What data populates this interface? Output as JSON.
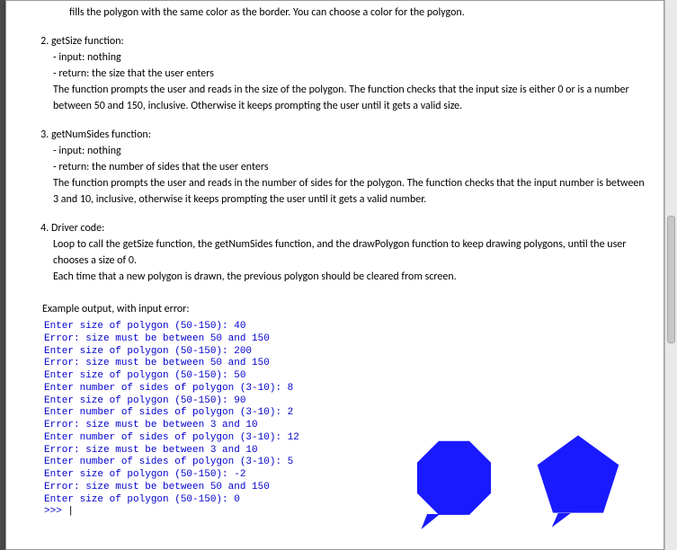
{
  "intro_partial": "fills the polygon with the same color as the border. You can choose a color for the polygon.",
  "items": [
    {
      "title": "getSize function:",
      "input": "- input: nothing",
      "ret": "- return: the size that the user enters",
      "body": "The function prompts the user and reads in the size of the polygon. The function checks that the input size is either 0 or is a number between 50 and 150, inclusive. Otherwise it keeps prompting the user until it gets a valid size."
    },
    {
      "title": "getNumSides function:",
      "input": "- input: nothing",
      "ret": "- return: the number of sides that the user enters",
      "body": "The function prompts the user and reads in the number of sides for the polygon. The function checks that the input number is between 3 and 10, inclusive, otherwise it keeps prompting the user until it gets a valid number."
    },
    {
      "title": "Driver code:",
      "body1": "Loop to call the getSize function, the getNumSides function, and the drawPolygon function to keep drawing polygons, until the user chooses a size of 0.",
      "body2": "Each time that a new polygon is drawn, the previous polygon should be cleared from screen."
    }
  ],
  "example_caption": "Example output, with input error:",
  "terminal_lines": [
    "Enter size of polygon (50-150): 40",
    "Error: size must be between 50 and 150",
    "Enter size of polygon (50-150): 200",
    "Error: size must be between 50 and 150",
    "Enter size of polygon (50-150): 50",
    "Enter number of sides of polygon (3-10): 8",
    "Enter size of polygon (50-150): 90",
    "Enter number of sides of polygon (3-10): 2",
    "Error: size must be between 3 and 10",
    "Enter number of sides of polygon (3-10): 12",
    "Error: size must be between 3 and 10",
    "Enter number of sides of polygon (3-10): 5",
    "Enter size of polygon (50-150): -2",
    "Error: size must be between 50 and 150",
    "Enter size of polygon (50-150): 0"
  ],
  "prompt": ">>> ",
  "shapes": {
    "octagon_sides": 8,
    "pentagon_sides": 5,
    "color": "#1a1aff"
  }
}
